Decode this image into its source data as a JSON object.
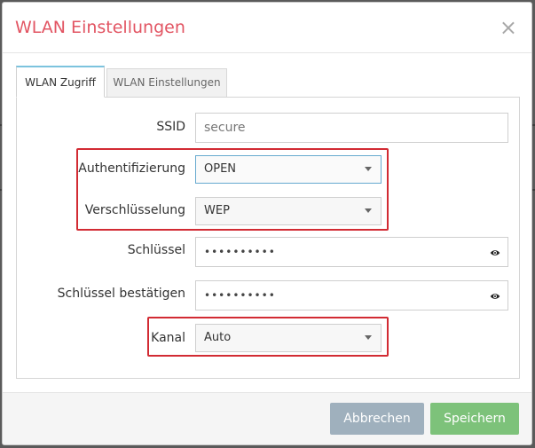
{
  "dialog": {
    "title": "WLAN Einstellungen",
    "close_symbol": "×"
  },
  "tabs": [
    {
      "label": "WLAN Zugriff",
      "active": true
    },
    {
      "label": "WLAN Einstellungen",
      "active": false
    }
  ],
  "form": {
    "ssid": {
      "label": "SSID",
      "value": "secure"
    },
    "authentication": {
      "label": "Authentifizierung",
      "value": "OPEN"
    },
    "encryption": {
      "label": "Verschlüsselung",
      "value": "WEP"
    },
    "key": {
      "label": "Schlüssel",
      "value": "••••••••••"
    },
    "key_confirm": {
      "label": "Schlüssel bestätigen",
      "value": "••••••••••"
    },
    "channel": {
      "label": "Kanal",
      "value": "Auto"
    }
  },
  "footer": {
    "cancel_label": "Abbrechen",
    "save_label": "Speichern"
  },
  "colors": {
    "title": "#e25563",
    "highlight": "#d22b33",
    "cancel_button": "#9fb0bd",
    "save_button": "#7dc27a",
    "active_tab_top": "#7cc3de"
  },
  "icons": {
    "close": "close-icon",
    "eye": "eye-icon",
    "caret": "chevron-down-icon"
  }
}
